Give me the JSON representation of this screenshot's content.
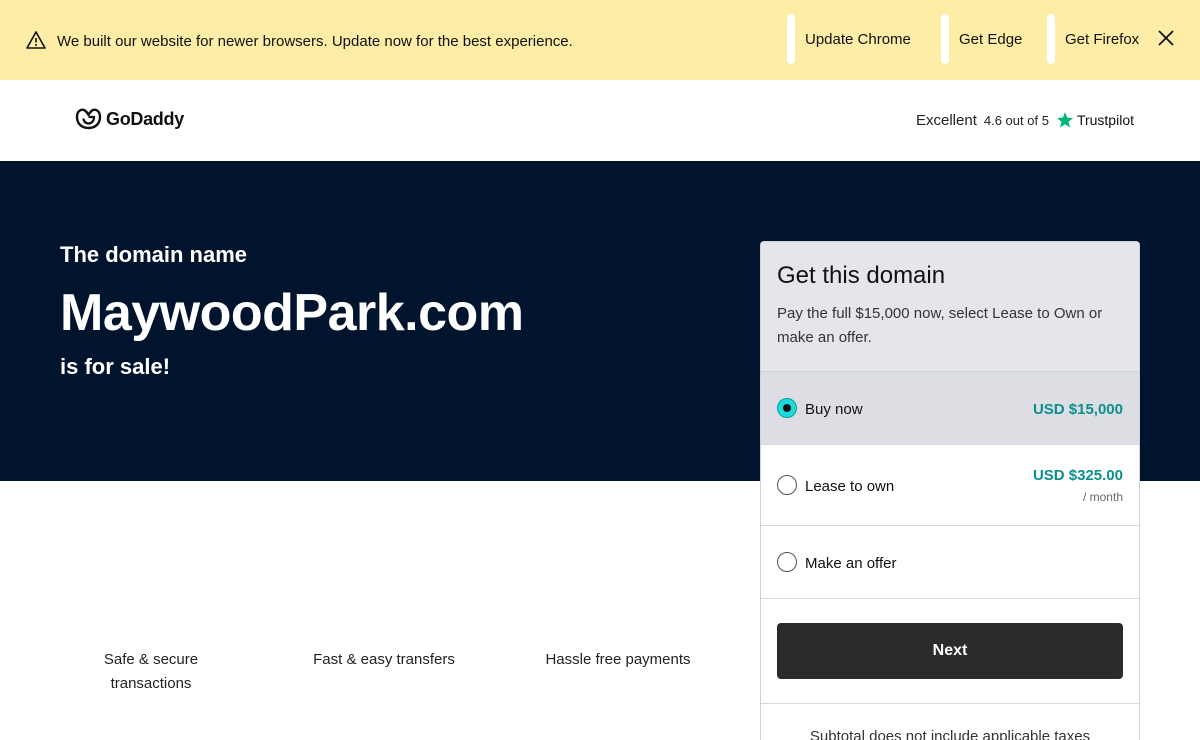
{
  "banner": {
    "message": "We built our website for newer browsers. Update now for the best experience.",
    "buttons": [
      {
        "label": "Update Chrome"
      },
      {
        "label": "Get Edge"
      },
      {
        "label": "Get Firefox"
      }
    ],
    "bg_color": "#fdeda6",
    "icons": {
      "warning": "warning-triangle-icon",
      "close": "close-icon"
    }
  },
  "header": {
    "logo_text": "GoDaddy",
    "rating": {
      "label": "Excellent",
      "score": "4.6 out of 5",
      "provider": "Trustpilot"
    }
  },
  "hero": {
    "pre_text": "The domain name",
    "domain": "MaywoodPark.com",
    "post_text": "is for sale!",
    "bg_color": "#00142e"
  },
  "card": {
    "title": "Get this domain",
    "description": "Pay the full $15,000 now, select Lease to Own or make an offer.",
    "options": [
      {
        "label": "Buy now",
        "price": "USD $15,000",
        "selected": true
      },
      {
        "label": "Lease to own",
        "price": "USD $325.00",
        "period": "/ month",
        "selected": false
      },
      {
        "label": "Make an offer",
        "selected": false
      }
    ],
    "next_label": "Next",
    "subtotal_note": "Subtotal does not include applicable taxes",
    "accent_color": "#0a8f8f"
  },
  "features": [
    {
      "line1": "Safe & secure",
      "line2": "transactions"
    },
    {
      "line1": "Fast & easy transfers"
    },
    {
      "line1": "Hassle free payments"
    }
  ]
}
